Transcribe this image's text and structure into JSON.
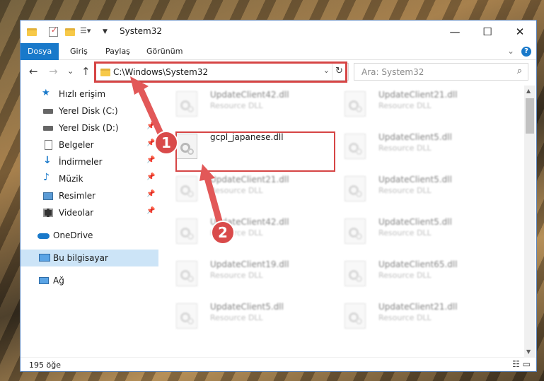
{
  "window": {
    "title": "System32",
    "controls": {
      "minimize": "—",
      "maximize": "☐",
      "close": "✕"
    }
  },
  "ribbon": {
    "tabs": [
      "Dosya",
      "Giriş",
      "Paylaş",
      "Görünüm"
    ],
    "help": "?",
    "expand": "⌄"
  },
  "nav": {
    "back": "←",
    "forward": "→",
    "recent": "⌄",
    "up": "↑",
    "address": "C:\\Windows\\System32",
    "refresh": "↻",
    "search_placeholder": "Ara: System32",
    "search_icon": "⌕"
  },
  "sidebar": {
    "items": [
      {
        "label": "Hızlı erişim",
        "icon": "star-icon"
      },
      {
        "label": "Yerel Disk (C:)",
        "icon": "drive-icon"
      },
      {
        "label": "Yerel Disk (D:)",
        "icon": "drive-icon"
      },
      {
        "label": "Belgeler",
        "icon": "documents-icon"
      },
      {
        "label": "İndirmeler",
        "icon": "download-icon"
      },
      {
        "label": "Müzik",
        "icon": "music-icon"
      },
      {
        "label": "Resimler",
        "icon": "pictures-icon"
      },
      {
        "label": "Videolar",
        "icon": "video-icon"
      },
      {
        "label": "OneDrive",
        "icon": "cloud-icon"
      },
      {
        "label": "Bu bilgisayar",
        "icon": "computer-icon"
      },
      {
        "label": "Ağ",
        "icon": "network-icon"
      }
    ],
    "pin_glyph": "📌"
  },
  "files": {
    "highlighted": {
      "name": "gcpl_japanese.dll"
    },
    "left_column": [
      {
        "name": "UpdateClient42.dll",
        "type": "Resource DLL"
      },
      {
        "name": "UpdateClient21.dll",
        "type": "Resource DLL"
      },
      {
        "name": "UpdateClient42.dll",
        "type": "Resource DLL"
      },
      {
        "name": "UpdateClient19.dll",
        "type": "Resource DLL"
      },
      {
        "name": "UpdateClient5.dll",
        "type": "Resource DLL"
      }
    ],
    "right_column": [
      {
        "name": "UpdateClient21.dll",
        "type": "Resource DLL"
      },
      {
        "name": "UpdateClient5.dll",
        "type": "Resource DLL"
      },
      {
        "name": "UpdateClient5.dll",
        "type": "Resource DLL"
      },
      {
        "name": "UpdateClient5.dll",
        "type": "Resource DLL"
      },
      {
        "name": "UpdateClient65.dll",
        "type": "Resource DLL"
      },
      {
        "name": "UpdateClient21.dll",
        "type": "Resource DLL"
      }
    ]
  },
  "status": {
    "count": "195 öğe"
  },
  "annotations": {
    "step1": "1",
    "step2": "2"
  },
  "colors": {
    "accent": "#1979ca",
    "highlight": "#d64545",
    "selection": "#cce4f7"
  }
}
